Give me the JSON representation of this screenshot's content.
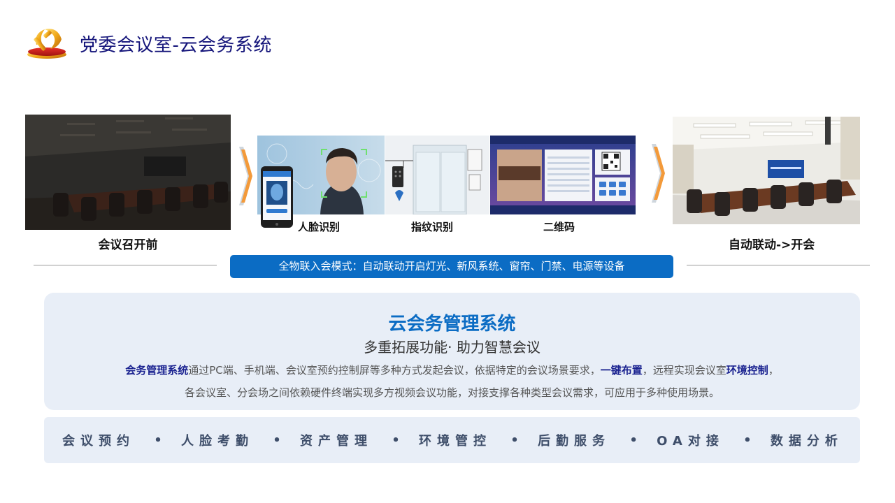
{
  "header": {
    "title": "党委会议室-云会务系统",
    "logo_icon": "party-emblem-icon"
  },
  "flow": {
    "before_caption": "会议召开前",
    "after_caption": "自动联动->开会",
    "tiles": [
      {
        "caption": "人脸识别"
      },
      {
        "caption": "指纹识别"
      },
      {
        "caption": "二维码"
      }
    ],
    "mode_text": "全物联入会模式：自动联动开启灯光、新风系统、窗帘、门禁、电源等设备"
  },
  "panel": {
    "title": "云会务管理系统",
    "subtitle": "多重拓展功能· 助力智慧会议",
    "desc": {
      "hl1": "会务管理系统",
      "t1": "通过PC端、手机端、会议室预约控制屏等多种方式发起会议，依据特定的会议场景要求，",
      "hl2": "一键布置",
      "t2": "，远程实现会议室",
      "hl3": "环境控制",
      "t3": "，",
      "line2": "各会议室、分会场之间依赖硬件终端实现多方视频会议功能，对接支撑各种类型会议需求，可应用于多种使用场景。"
    }
  },
  "features": [
    "会议预约",
    "人脸考勤",
    "资产管理",
    "环境管控",
    "后勤服务",
    "OA对接",
    "数据分析"
  ],
  "colors": {
    "title": "#14147a",
    "accent_blue": "#0b6cc4",
    "highlight": "#1a2290",
    "arrow": "#f39a3a",
    "panel_bg": "#e8eef7"
  }
}
